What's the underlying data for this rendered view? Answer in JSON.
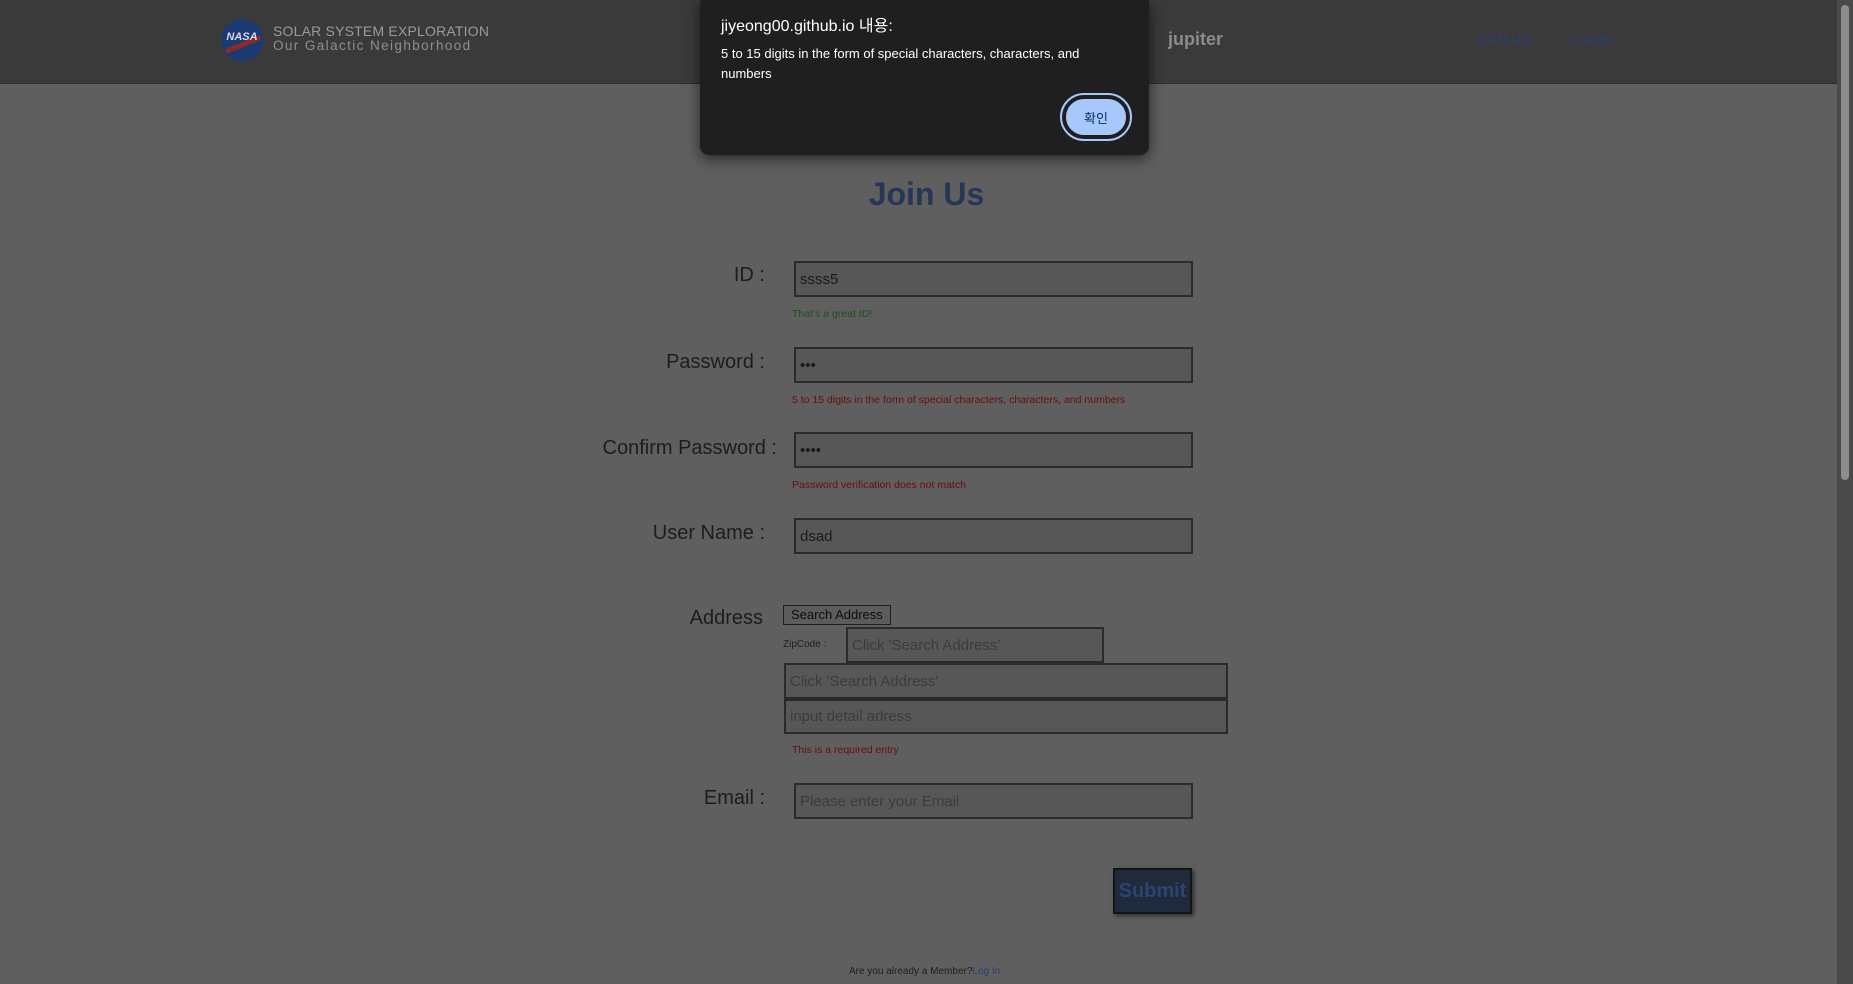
{
  "header": {
    "brand_line1": "SOLAR SYSTEM EXPLORATION",
    "brand_line2": "Our Galactic Neighborhood",
    "logo_text": "NASA",
    "nav_jupiter": "jupiter",
    "nav_join": "JOIN US",
    "nav_login": "LOGIN"
  },
  "dialog": {
    "title": "jiyeong00.github.io 내용:",
    "message": "5 to 15 digits in the form of special characters, characters, and numbers",
    "ok_label": "확인"
  },
  "form": {
    "title": "Join Us",
    "id": {
      "label": "ID :",
      "value": "ssss5",
      "message": "That's a great ID!"
    },
    "password": {
      "label": "Password :",
      "value": "•••",
      "message": "5 to 15 digits in the form of special characters, characters, and numbers"
    },
    "confirm_password": {
      "label": "Confirm Password :",
      "value": "••••",
      "message": "Password verification does not match"
    },
    "user_name": {
      "label": "User Name :",
      "value": "dsad"
    },
    "address": {
      "label": "Address",
      "search_button": "Search Address",
      "zipcode_label": "ZipCode :",
      "zipcode_placeholder": "Click 'Search Address'",
      "address_placeholder": "Click 'Search Address'",
      "detail_placeholder": "input detail adress",
      "message": "This is a required entry"
    },
    "email": {
      "label": "Email :",
      "placeholder": "Please enter your Email"
    },
    "submit_label": "Submit",
    "member_text": "Are you already a Member?",
    "login_link": "Log In"
  },
  "colors": {
    "overlay_bg": "#5f5f5f",
    "dialog_bg": "#1f1f1f",
    "dialog_button": "#a8c7fa",
    "ok_message": "#1f4f1f",
    "error_message": "#6c0b0b",
    "submit_bg": "#1f2a3c"
  }
}
